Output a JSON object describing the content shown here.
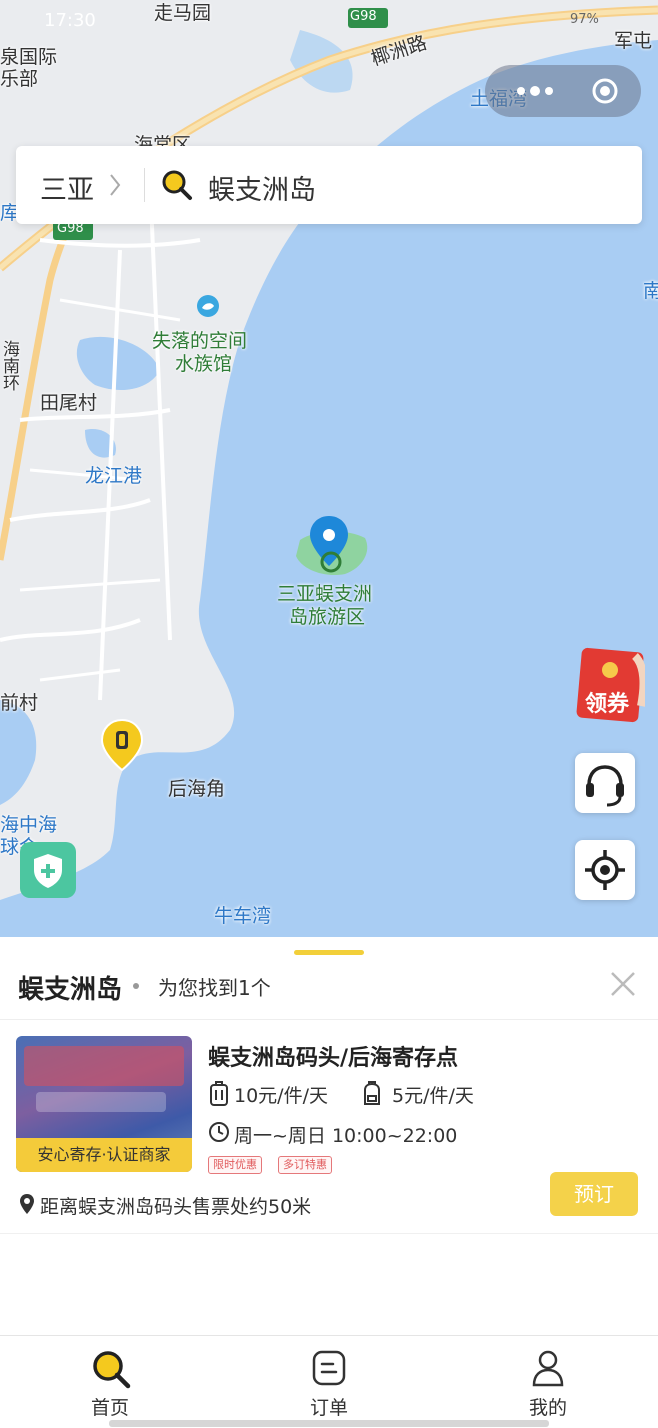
{
  "status_bar": {
    "time": "17:30",
    "battery": "97%"
  },
  "map": {
    "labels": {
      "zoumayuan": "走马园",
      "g98_top": "G98",
      "yezhoulu": "椰洲路",
      "junzhe": "军屯",
      "tufuwan": "土福湾",
      "international": "泉国际",
      "club": "乐部",
      "haitang": "海棠区",
      "ku": "库",
      "g98_left": "G98",
      "nan": "南",
      "aquarium_1": "失落的空间",
      "aquarium_2": "水族馆",
      "hainan_ring": "海南环",
      "tianwei": "田尾村",
      "longjiang": "龙江港",
      "scenic_1": "三亚蜈支洲",
      "scenic_2": "岛旅游区",
      "qiancun": "前村",
      "houhaijiao": "后海角",
      "haizhonghai": "海中海",
      "golf": "球会",
      "niuchewan": "牛车湾"
    },
    "coupon_label": "领券"
  },
  "search": {
    "city": "三亚",
    "query": "蜈支洲岛"
  },
  "panel": {
    "title": "蜈支洲岛",
    "count": "为您找到1个",
    "item": {
      "name": "蜈支洲岛码头/后海寄存点",
      "badge": "安心寄存·认证商家",
      "price_suitcase": "10元/件/天",
      "price_bag": "5元/件/天",
      "hours": "周一~周日 10:00~22:00",
      "tags": [
        "限时优惠",
        "多订特惠"
      ],
      "distance": "距离蜈支洲岛码头售票处约50米",
      "book_label": "预订"
    }
  },
  "tabs": [
    {
      "label": "首页",
      "icon": "search-icon"
    },
    {
      "label": "订单",
      "icon": "order-icon"
    },
    {
      "label": "我的",
      "icon": "user-icon"
    }
  ],
  "colors": {
    "accent": "#f4d24a",
    "sea": "#a9cdf3",
    "pin_blue": "#1e88d9",
    "shield_green": "#4cc6a0"
  }
}
